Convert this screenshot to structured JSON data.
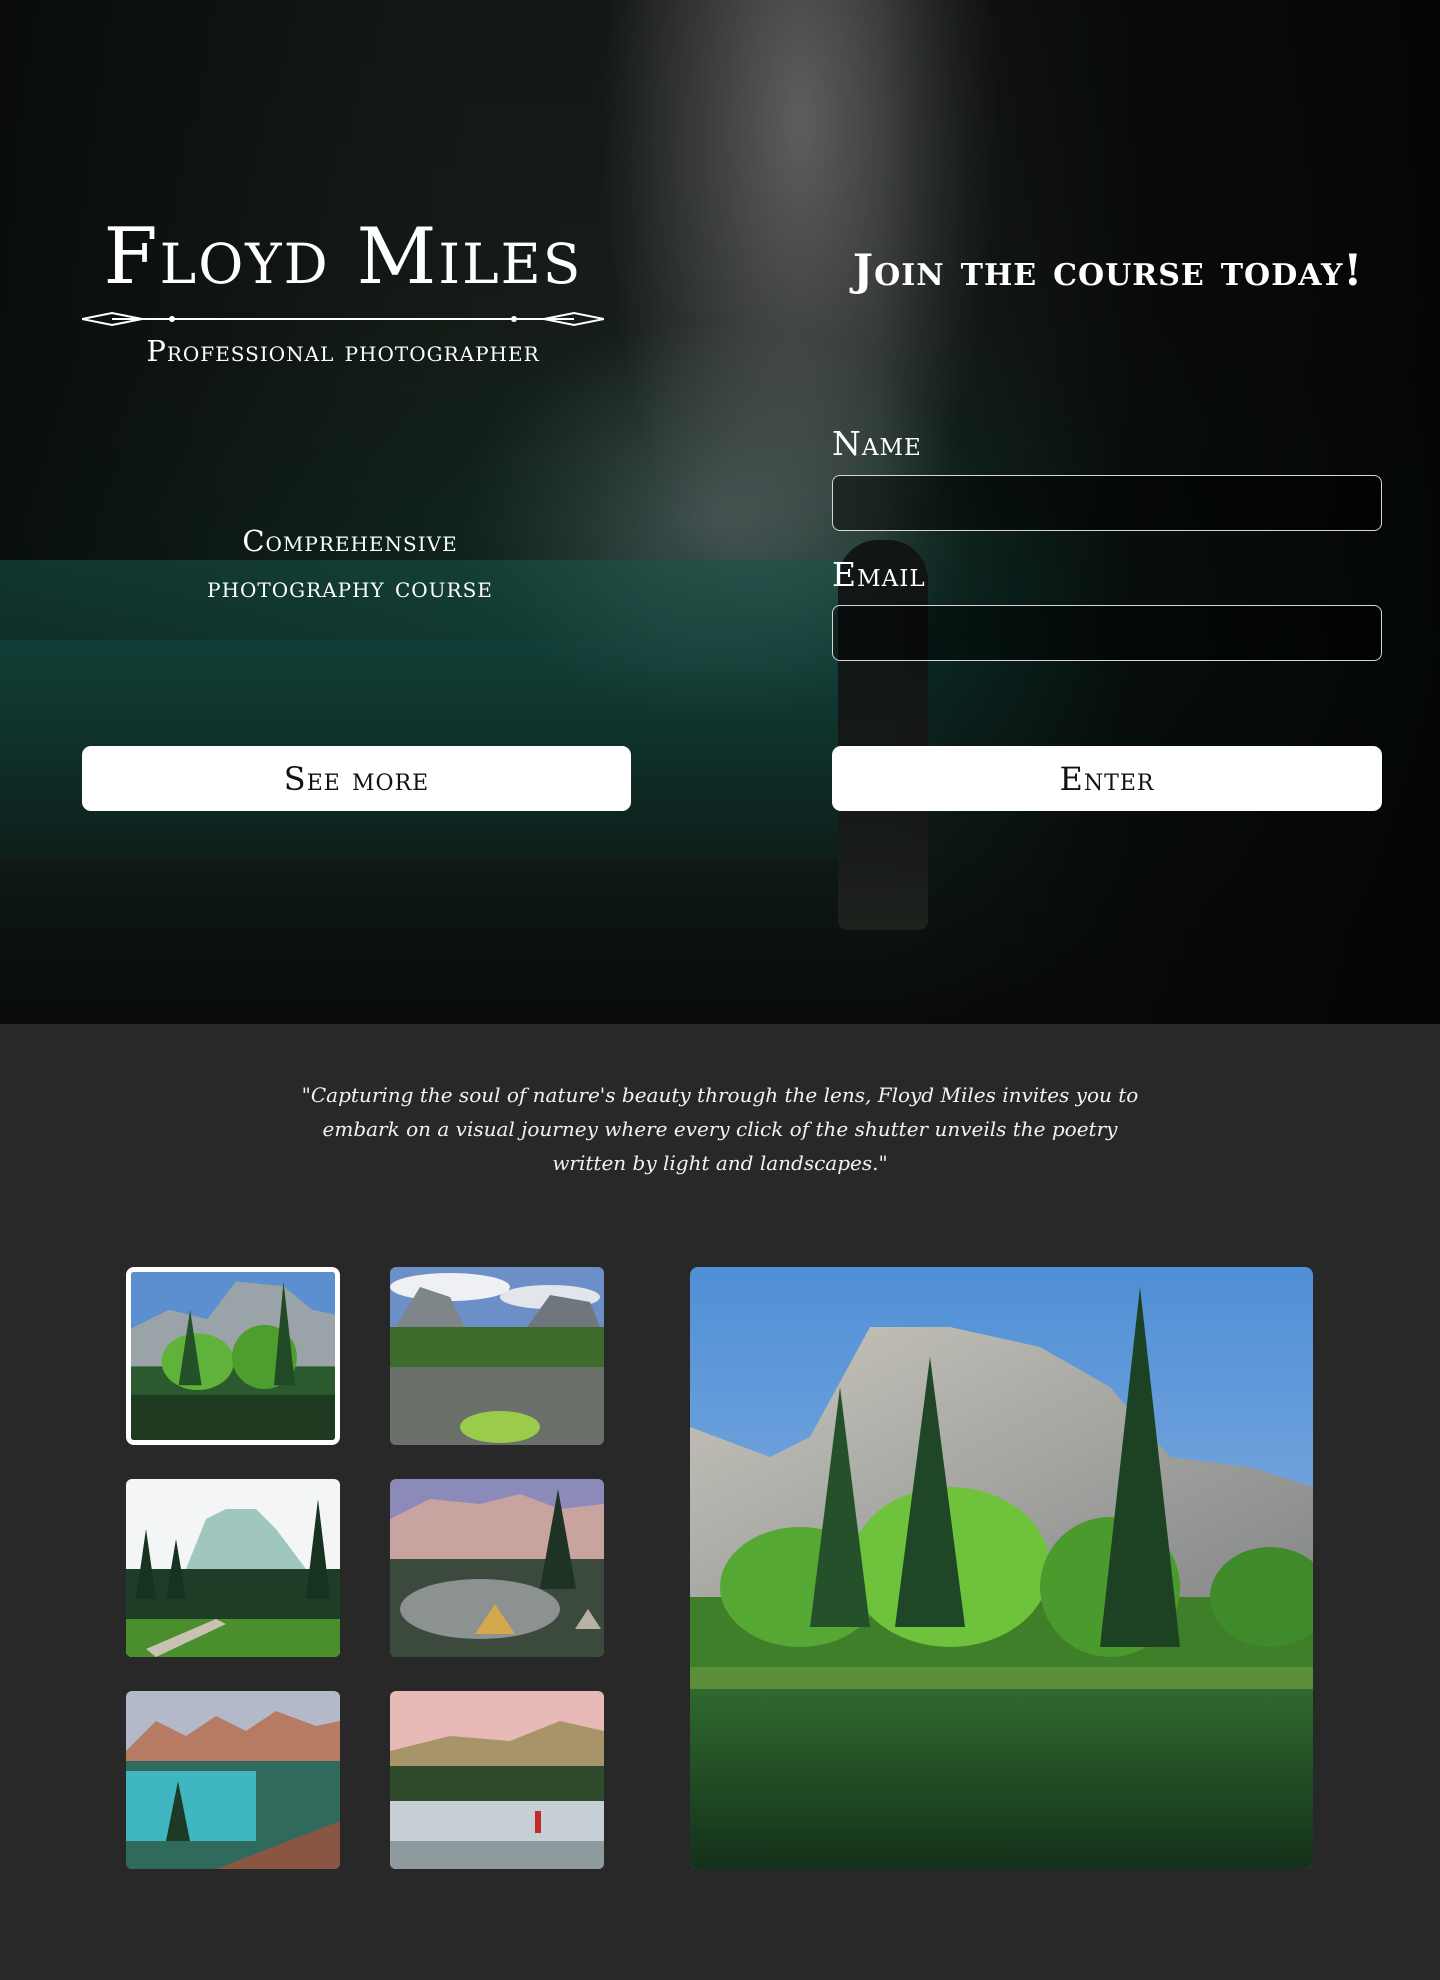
{
  "hero": {
    "brand_name": "Floyd Miles",
    "brand_subtitle": "Professional photographer",
    "course_line1": "Comprehensive",
    "course_line2": "photography course",
    "see_more_label": "See more"
  },
  "signup": {
    "title": "Join the course today!",
    "name_label": "Name",
    "name_value": "",
    "email_label": "Email",
    "email_value": "",
    "enter_label": "Enter"
  },
  "quote": {
    "text": "\"Capturing the soul of nature's beauty through the lens, Floyd Miles invites you to embark on a visual journey where every click of the shutter unveils the poetry written by light and landscapes.\""
  },
  "gallery": {
    "selected_index": 0,
    "thumbnails": [
      {
        "name": "gallery-thumb-el-capitan",
        "selected": true
      },
      {
        "name": "gallery-thumb-river-valley",
        "selected": false
      },
      {
        "name": "gallery-thumb-pine-meadow",
        "selected": false
      },
      {
        "name": "gallery-thumb-mountain-camp",
        "selected": false
      },
      {
        "name": "gallery-thumb-turquoise-lake",
        "selected": false
      },
      {
        "name": "gallery-thumb-misty-lake",
        "selected": false
      }
    ]
  },
  "colors": {
    "page_background": "#282828",
    "button_background": "#ffffff",
    "button_text": "#111111",
    "text": "#ffffff",
    "input_border": "#d6d6d6"
  }
}
